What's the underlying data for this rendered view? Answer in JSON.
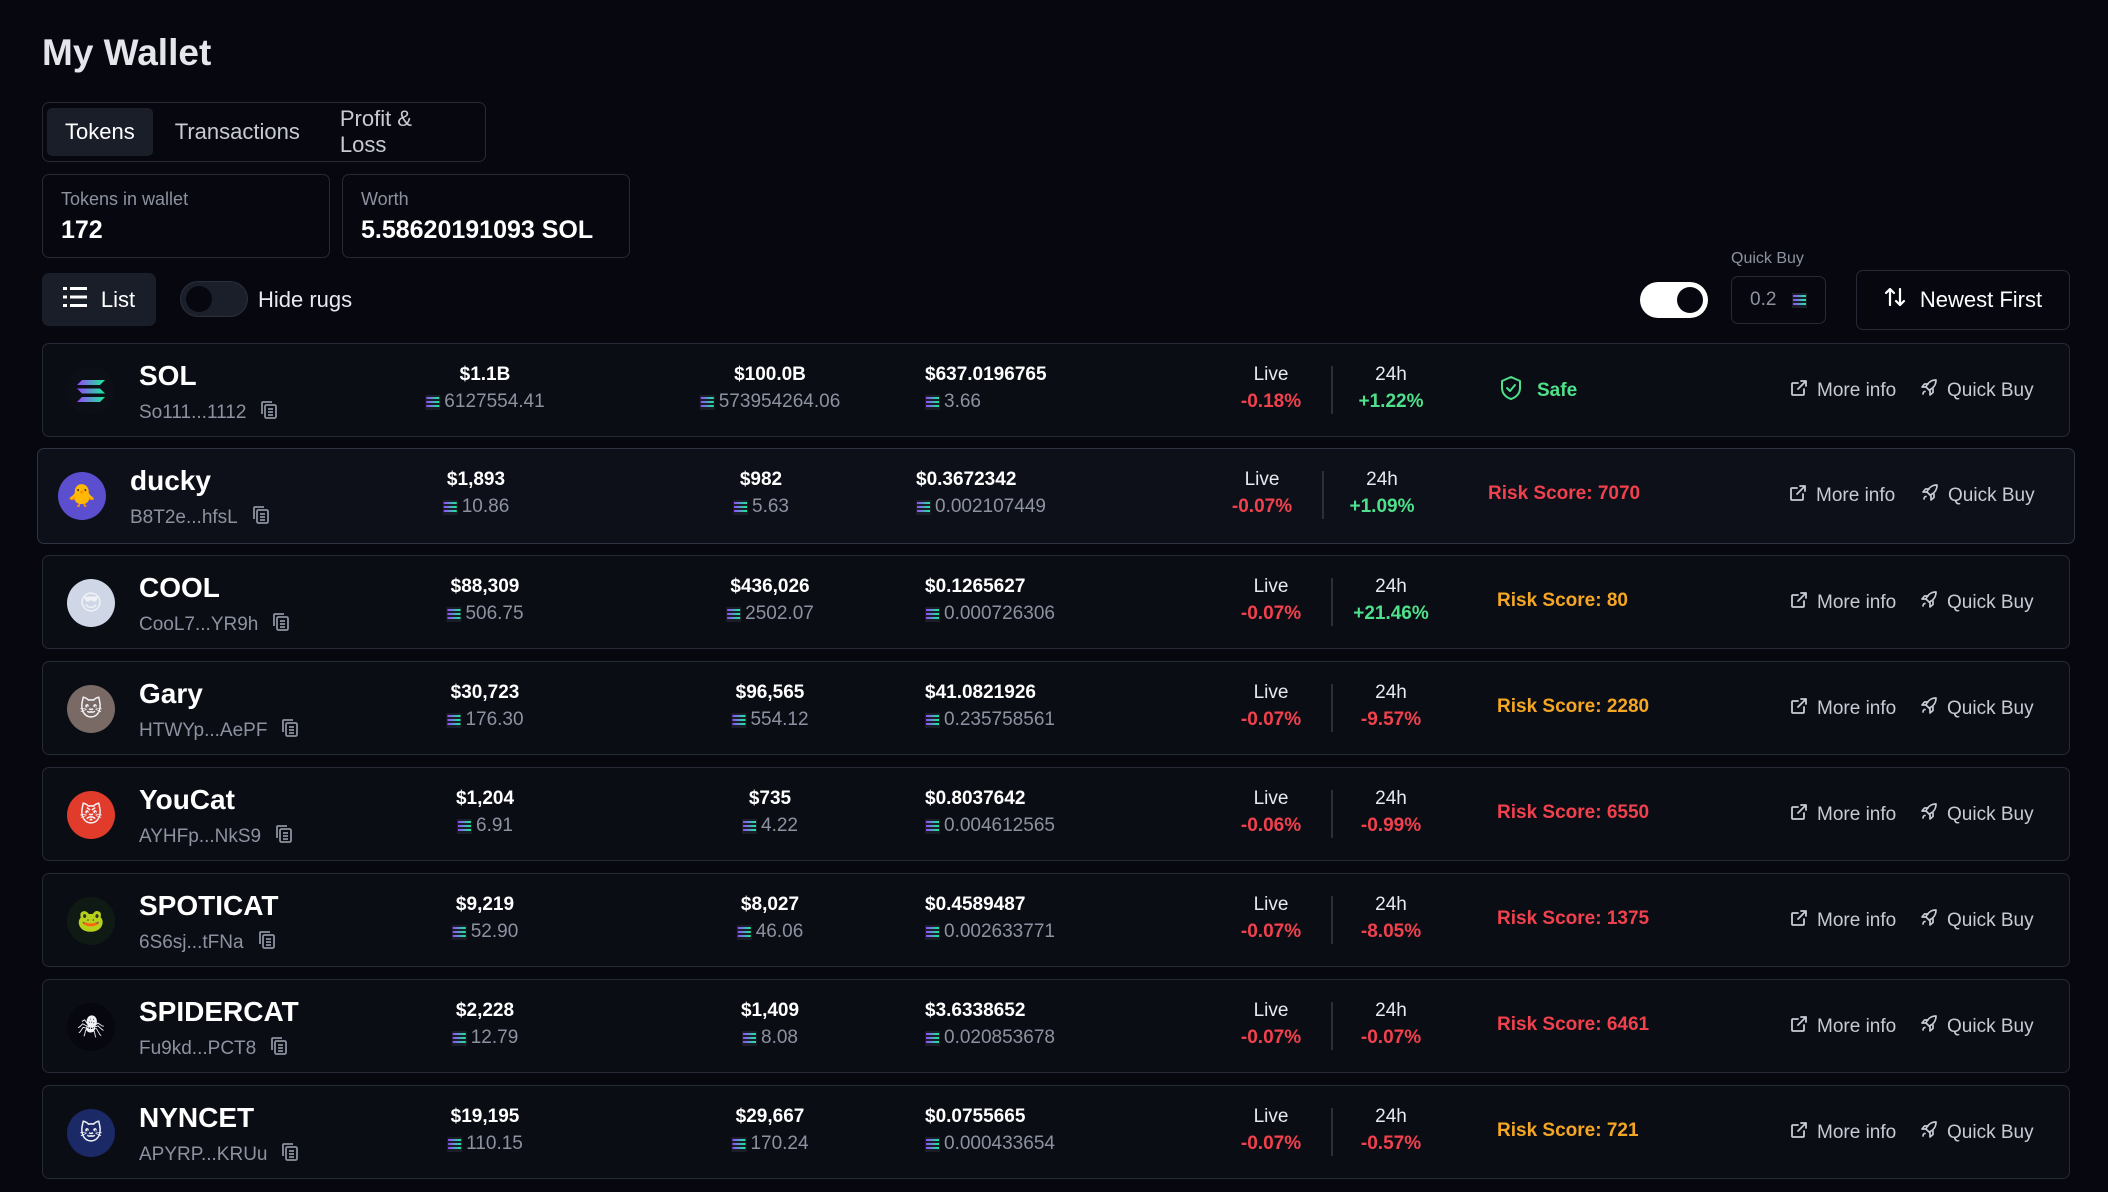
{
  "page": {
    "title": "My Wallet"
  },
  "tabs": [
    {
      "label": "Tokens",
      "active": true
    },
    {
      "label": "Transactions",
      "active": false
    },
    {
      "label": "Profit & Loss",
      "active": false
    }
  ],
  "stats": {
    "tokens_label": "Tokens in wallet",
    "tokens_value": "172",
    "worth_label": "Worth",
    "worth_value": "5.58620191093 SOL"
  },
  "toolbar": {
    "list_label": "List",
    "hide_rugs_label": "Hide rugs",
    "hide_rugs_on": false,
    "live_toggle_on": true,
    "quick_buy_label": "Quick Buy",
    "quick_buy_value": "0.2",
    "sort_label": "Newest First"
  },
  "colors": {
    "background": "#07080f",
    "negative": "#f0414d",
    "positive": "#4ee08a",
    "risk_orange": "#f5a623",
    "border": "#262a36"
  },
  "actions": {
    "more_info": "More info",
    "quick_buy": "Quick Buy"
  },
  "change_labels": {
    "live": "Live",
    "day": "24h"
  },
  "tokens": [
    {
      "name": "SOL",
      "address": "So111...1112",
      "logo": "sol-logo-icon",
      "col1_usd": "$1.1B",
      "col1_sol": "6127554.41",
      "col2_usd": "$100.0B",
      "col2_sol": "573954264.06",
      "price_usd": "$637.0196765",
      "price_sol": "3.66",
      "live": "-0.18%",
      "day": "+1.22%",
      "risk": "Safe",
      "risk_type": "safe"
    },
    {
      "name": "ducky",
      "address": "B8T2e...hfsL",
      "logo": "duck-icon",
      "col1_usd": "$1,893",
      "col1_sol": "10.86",
      "col2_usd": "$982",
      "col2_sol": "5.63",
      "price_usd": "$0.3672342",
      "price_sol": "0.002107449",
      "live": "-0.07%",
      "day": "+1.09%",
      "risk": "Risk Score: 7070",
      "risk_type": "red"
    },
    {
      "name": "COOL",
      "address": "CooL7...YR9h",
      "logo": "cool-dog-icon",
      "col1_usd": "$88,309",
      "col1_sol": "506.75",
      "col2_usd": "$436,026",
      "col2_sol": "2502.07",
      "price_usd": "$0.1265627",
      "price_sol": "0.000726306",
      "live": "-0.07%",
      "day": "+21.46%",
      "risk": "Risk Score: 80",
      "risk_type": "orange"
    },
    {
      "name": "Gary",
      "address": "HTWYp...AePF",
      "logo": "cat-icon",
      "col1_usd": "$30,723",
      "col1_sol": "176.30",
      "col2_usd": "$96,565",
      "col2_sol": "554.12",
      "price_usd": "$41.0821926",
      "price_sol": "0.235758561",
      "live": "-0.07%",
      "day": "-9.57%",
      "risk": "Risk Score: 2280",
      "risk_type": "orange"
    },
    {
      "name": "YouCat",
      "address": "AYHFp...NkS9",
      "logo": "red-cat-icon",
      "col1_usd": "$1,204",
      "col1_sol": "6.91",
      "col2_usd": "$735",
      "col2_sol": "4.22",
      "price_usd": "$0.8037642",
      "price_sol": "0.004612565",
      "live": "-0.06%",
      "day": "-0.99%",
      "risk": "Risk Score: 6550",
      "risk_type": "red"
    },
    {
      "name": "SPOTICAT",
      "address": "6S6sj...tFNa",
      "logo": "green-cat-icon",
      "col1_usd": "$9,219",
      "col1_sol": "52.90",
      "col2_usd": "$8,027",
      "col2_sol": "46.06",
      "price_usd": "$0.4589487",
      "price_sol": "0.002633771",
      "live": "-0.07%",
      "day": "-8.05%",
      "risk": "Risk Score: 1375",
      "risk_type": "red"
    },
    {
      "name": "SPIDERCAT",
      "address": "Fu9kd...PCT8",
      "logo": "spider-icon",
      "col1_usd": "$2,228",
      "col1_sol": "12.79",
      "col2_usd": "$1,409",
      "col2_sol": "8.08",
      "price_usd": "$3.6338652",
      "price_sol": "0.020853678",
      "live": "-0.07%",
      "day": "-0.07%",
      "risk": "Risk Score: 6461",
      "risk_type": "red"
    },
    {
      "name": "NYNCET",
      "address": "APYRP...KRUu",
      "logo": "nyan-cat-icon",
      "col1_usd": "$19,195",
      "col1_sol": "110.15",
      "col2_usd": "$29,667",
      "col2_sol": "170.24",
      "price_usd": "$0.0755665",
      "price_sol": "0.000433654",
      "live": "-0.07%",
      "day": "-0.57%",
      "risk": "Risk Score: 721",
      "risk_type": "orange"
    }
  ]
}
